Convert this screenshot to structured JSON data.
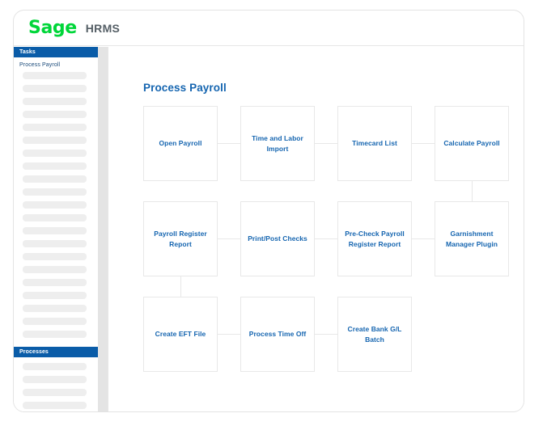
{
  "header": {
    "brand": "Sage",
    "product": "HRMS"
  },
  "sidebar": {
    "sections": [
      {
        "title": "Tasks",
        "links": [
          "Process Payroll"
        ],
        "placeholder_count": 21
      },
      {
        "title": "Processes",
        "links": [],
        "placeholder_count": 4
      }
    ]
  },
  "main": {
    "title": "Process Payroll",
    "flow_rows": [
      {
        "boxes": [
          "Open Payroll",
          "Time and Labor Import",
          "Timecard List",
          "Calculate Payroll"
        ]
      },
      {
        "boxes": [
          "Payroll Register Report",
          "Print/Post Checks",
          "Pre-Check Payroll Register Report",
          "Garnishment Manager Plugin"
        ]
      },
      {
        "boxes": [
          "Create EFT File",
          "Process Time Off",
          "Create Bank G/L Batch"
        ]
      }
    ]
  },
  "colors": {
    "brand_green": "#00d639",
    "nav_blue": "#0a5ca8",
    "link_blue": "#1565b0",
    "border_gray": "#e8e8e8",
    "placeholder_gray": "#eeeeee"
  }
}
